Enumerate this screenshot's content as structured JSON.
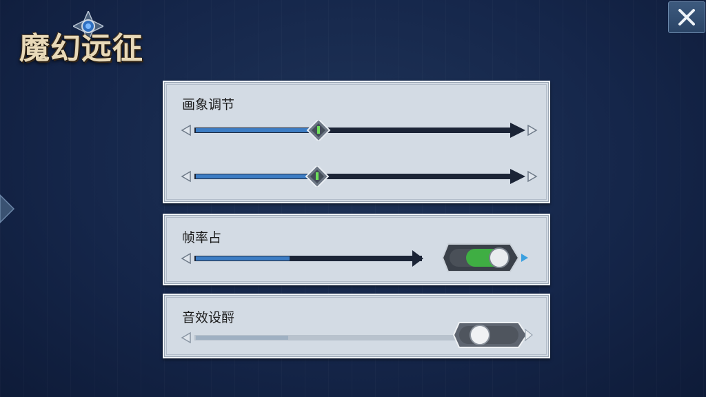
{
  "game": {
    "title": "魔幻远征"
  },
  "panels": {
    "graphics": {
      "title": "画象调节",
      "slider1_level": 0.36,
      "slider2_level": 0.36
    },
    "framerate": {
      "title": "帧率占",
      "slider_level": 0.4,
      "toggle_on": true
    },
    "sound": {
      "title": "音效设酹",
      "slider_level": 0.3,
      "toggle_on": false
    }
  },
  "colors": {
    "fill": "#3d7dc4",
    "track": "#1b2436",
    "toggle_on": "#3fae43",
    "accent": "#3aa0e0"
  },
  "icons": [
    "close-icon",
    "game-emblem-icon",
    "arrow-left-icon",
    "arrow-right-icon",
    "thumb-gem-icon"
  ]
}
